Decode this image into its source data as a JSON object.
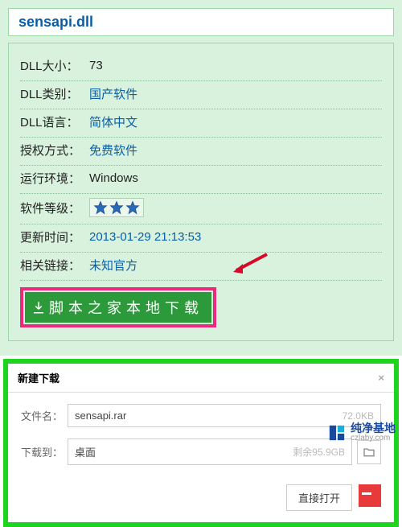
{
  "title": "sensapi.dll",
  "info": {
    "size_label": "DLL大小：",
    "size_value": "73",
    "category_label": "DLL类别：",
    "category_value": "国产软件",
    "lang_label": "DLL语言：",
    "lang_value": "简体中文",
    "license_label": "授权方式：",
    "license_value": "免费软件",
    "env_label": "运行环境：",
    "env_value": "Windows",
    "rating_label": "软件等级：",
    "rating_value": "3",
    "updated_label": "更新时间：",
    "updated_value": "2013-01-29 21:13:53",
    "related_label": "相关链接：",
    "related_value": "未知官方"
  },
  "download_button": "脚本之家本地下载",
  "dialog": {
    "title": "新建下载",
    "filename_label": "文件名：",
    "filename_value": "sensapi.rar",
    "filesize": "72.0KB",
    "saveto_label": "下载到：",
    "saveto_value": "桌面",
    "diskfree": "剩余95.9GB",
    "open_button": "直接打开"
  },
  "watermark": {
    "brand": "纯净基地",
    "url": "czlaby.com"
  },
  "colors": {
    "accent_blue": "#0a5ea8",
    "panel_green": "#d8f2dd",
    "btn_green": "#2c9a3b",
    "highlight_pink": "#ea2a7a",
    "frame_green": "#1fd41f"
  }
}
